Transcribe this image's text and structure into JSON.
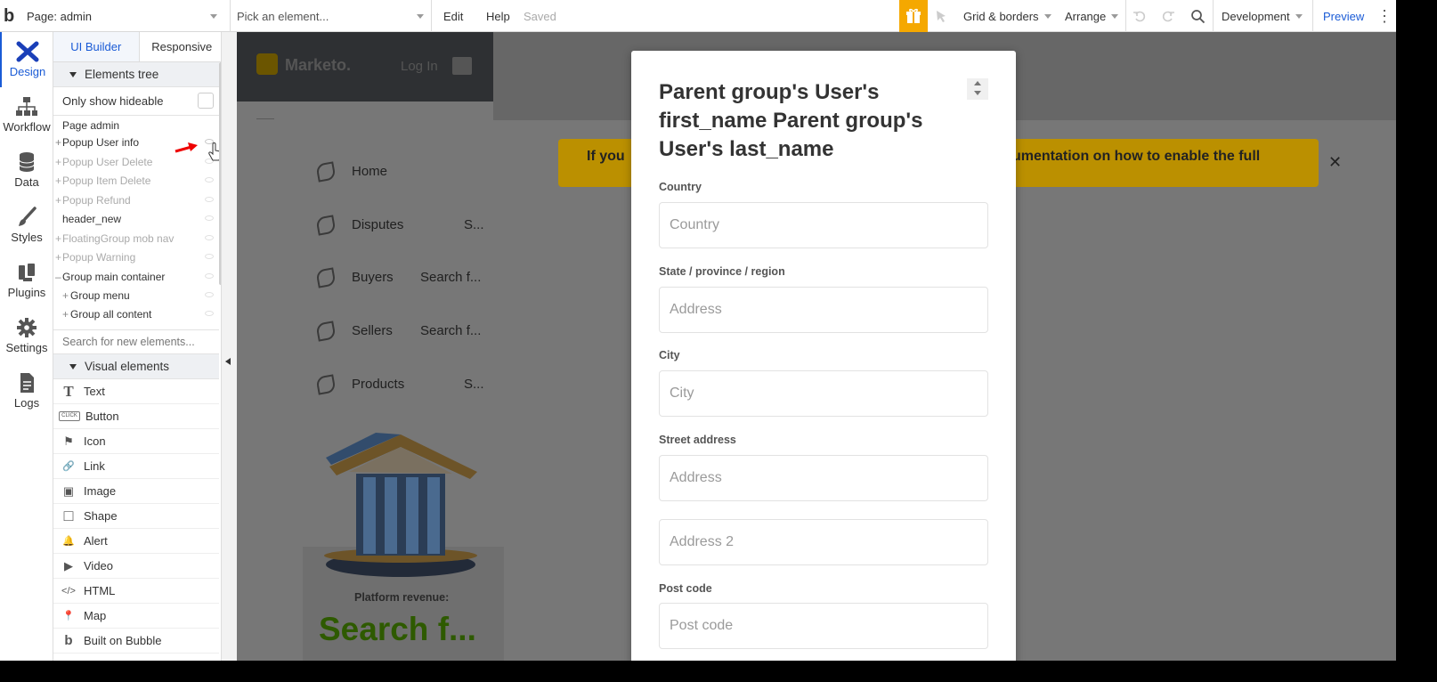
{
  "topbar": {
    "logo": "b",
    "page_selector": "Page: admin",
    "element_picker": "Pick an element...",
    "edit": "Edit",
    "help": "Help",
    "saved": "Saved",
    "grid_borders": "Grid & borders",
    "arrange": "Arrange",
    "environment": "Development",
    "preview": "Preview"
  },
  "rail": {
    "items": [
      {
        "label": "Design",
        "icon": "design-icon",
        "active": true
      },
      {
        "label": "Workflow",
        "icon": "workflow-icon"
      },
      {
        "label": "Data",
        "icon": "database-icon"
      },
      {
        "label": "Styles",
        "icon": "brush-icon"
      },
      {
        "label": "Plugins",
        "icon": "plug-icon"
      },
      {
        "label": "Settings",
        "icon": "gear-icon"
      },
      {
        "label": "Logs",
        "icon": "document-icon"
      }
    ]
  },
  "panel": {
    "tabs": [
      "UI Builder",
      "Responsive"
    ],
    "elements_tree_title": "Elements tree",
    "only_show_hideable": "Only show hideable",
    "tree": [
      {
        "label": "Page admin",
        "prefix": "",
        "dim": false
      },
      {
        "label": "Popup User info",
        "prefix": "+",
        "dim": false
      },
      {
        "label": "Popup User Delete",
        "prefix": "+",
        "dim": true
      },
      {
        "label": "Popup Item Delete",
        "prefix": "+",
        "dim": true
      },
      {
        "label": "Popup Refund",
        "prefix": "+",
        "dim": true
      },
      {
        "label": "header_new",
        "prefix": "",
        "dim": false
      },
      {
        "label": "FloatingGroup mob nav",
        "prefix": "+",
        "dim": true
      },
      {
        "label": "Popup Warning",
        "prefix": "+",
        "dim": true
      },
      {
        "label": "Group main container",
        "prefix": "–",
        "dim": false
      },
      {
        "label": "Group menu",
        "prefix": "+",
        "dim": false,
        "indent": true
      },
      {
        "label": "Group all content",
        "prefix": "+",
        "dim": false,
        "indent": true
      }
    ],
    "search_placeholder": "Search for new elements...",
    "visual_elements_title": "Visual elements",
    "visual_elements": [
      {
        "label": "Text",
        "icon": "T"
      },
      {
        "label": "Button",
        "icon": "CLICK"
      },
      {
        "label": "Icon",
        "icon": "⚑"
      },
      {
        "label": "Link",
        "icon": "🔗"
      },
      {
        "label": "Image",
        "icon": "▣"
      },
      {
        "label": "Shape",
        "icon": "□"
      },
      {
        "label": "Alert",
        "icon": "🔔"
      },
      {
        "label": "Video",
        "icon": "▶"
      },
      {
        "label": "HTML",
        "icon": "</>"
      },
      {
        "label": "Map",
        "icon": "📍"
      },
      {
        "label": "Built on Bubble",
        "icon": "b"
      }
    ]
  },
  "canvas": {
    "brand": "Marketo.",
    "login": "Log In",
    "nav": [
      {
        "label": "Home",
        "extra": ""
      },
      {
        "label": "Disputes",
        "extra": "S..."
      },
      {
        "label": "Buyers",
        "extra": "Search f..."
      },
      {
        "label": "Sellers",
        "extra": "Search f..."
      },
      {
        "label": "Products",
        "extra": "S..."
      }
    ],
    "banner_left": "If you",
    "banner_right": "umentation on how to enable the full",
    "close": "✕",
    "platform_revenue": "Platform revenue:",
    "revenue_value": "Search f..."
  },
  "modal": {
    "title": "Parent group's User's first_name Parent group's User's last_name",
    "fields": [
      {
        "label": "Country",
        "placeholder": "Country"
      },
      {
        "label": "State / province / region",
        "placeholder": "Address"
      },
      {
        "label": "City",
        "placeholder": "City"
      },
      {
        "label": "Street address",
        "placeholder": "Address"
      },
      {
        "label": "",
        "placeholder": "Address 2"
      },
      {
        "label": "Post code",
        "placeholder": "Post code"
      }
    ]
  },
  "colors": {
    "accent": "#1a5bd6",
    "gift": "#f5a800",
    "banner": "#bb9000",
    "revenue": "#2e5a00"
  }
}
